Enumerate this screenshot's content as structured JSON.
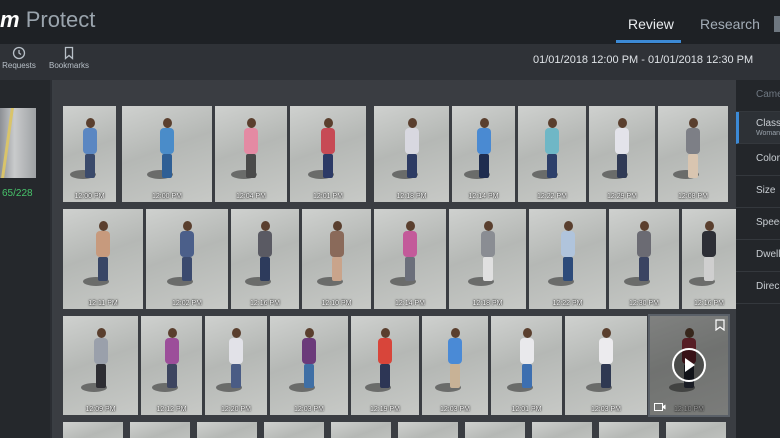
{
  "header": {
    "brand_prefix": "m",
    "brand_name": "Protect",
    "tabs": [
      {
        "label": "Review",
        "active": true
      },
      {
        "label": "Research",
        "active": false
      }
    ]
  },
  "toolbar": {
    "requests_label": "Requests",
    "bookmarks_label": "Bookmarks",
    "date_range": "01/01/2018 12:00 PM - 01/01/2018 12:30 PM"
  },
  "left_panel": {
    "count": "65/228"
  },
  "filters": {
    "camera": "Came",
    "class_label": "Class",
    "class_value": "Woman",
    "color": "Color",
    "size": "Size",
    "speed": "Speed",
    "dwell": "Dwell",
    "direction": "Direc"
  },
  "colors": {
    "accent": "#3c8ad6",
    "count_green": "#47c26a",
    "background": "#2b2e33"
  },
  "results": {
    "rows": [
      {
        "items": [
          {
            "time": "12:00 PM",
            "shirt": "#5b87c2",
            "pants": "#3a4a6b"
          },
          {
            "time": "12:00 PM",
            "shirt": "#4a8cc9",
            "pants": "#2f5f95"
          },
          {
            "time": "12:04 PM",
            "shirt": "#e48aa3",
            "pants": "#4a4a4a"
          },
          {
            "time": "12:01 PM",
            "shirt": "#c74a55",
            "pants": "#2c3a66"
          },
          {
            "time": "12:18 PM",
            "shirt": "#d8d8e0",
            "pants": "#2d3b63"
          },
          {
            "time": "12:14 PM",
            "shirt": "#4a8ad2",
            "pants": "#1f2d4f"
          },
          {
            "time": "12:22 PM",
            "shirt": "#6fb7c6",
            "pants": "#2d3f6a"
          },
          {
            "time": "12:29 PM",
            "shirt": "#e3e3ea",
            "pants": "#303a55"
          },
          {
            "time": "12:08 PM",
            "shirt": "#7d7f86",
            "pants": "#d9c5b0"
          }
        ]
      },
      {
        "items": [
          {
            "time": "12:11 PM",
            "shirt": "#c79a7d",
            "pants": "#384666"
          },
          {
            "time": "12:02 PM",
            "shirt": "#4b5f8a",
            "pants": "#3b4a6e"
          },
          {
            "time": "12:16 PM",
            "shirt": "#5a5a63",
            "pants": "#2d3b5c"
          },
          {
            "time": "12:10 PM",
            "shirt": "#8a6a5a",
            "pants": "#c9a48b"
          },
          {
            "time": "12:14 PM",
            "shirt": "#c35a9a",
            "pants": "#6b6f7b"
          },
          {
            "time": "12:18 PM",
            "shirt": "#8a8d93",
            "pants": "#e0e0e0"
          },
          {
            "time": "12:22 PM",
            "shirt": "#b0c4dc",
            "pants": "#2d4b7a"
          },
          {
            "time": "12:30 PM",
            "shirt": "#6b6b73",
            "pants": "#3a4462"
          },
          {
            "time": "12:16 PM",
            "shirt": "#2d2f36",
            "pants": "#cfcfcf"
          }
        ]
      },
      {
        "items": [
          {
            "time": "12:09 PM",
            "shirt": "#9aa0ab",
            "pants": "#2e2e33"
          },
          {
            "time": "12:12 PM",
            "shirt": "#9c4e9a",
            "pants": "#3d4560"
          },
          {
            "time": "12:20 PM",
            "shirt": "#e2e2e8",
            "pants": "#4a5c85"
          },
          {
            "time": "12:03 PM",
            "shirt": "#6b3a7a",
            "pants": "#3f6fa5"
          },
          {
            "time": "12:19 PM",
            "shirt": "#d8453a",
            "pants": "#2d3655"
          },
          {
            "time": "12:03 PM",
            "shirt": "#4a8ad6",
            "pants": "#c8b296"
          },
          {
            "time": "12:01 PM",
            "shirt": "#e9e9ec",
            "pants": "#3d6fb0"
          },
          {
            "time": "12:03 PM",
            "shirt": "#ecebee",
            "pants": "#2f3952"
          },
          {
            "time": "12:10 PM",
            "shirt": "#8b2f3a",
            "pants": "#2b2f3d"
          }
        ]
      }
    ],
    "row4_count": 10
  }
}
